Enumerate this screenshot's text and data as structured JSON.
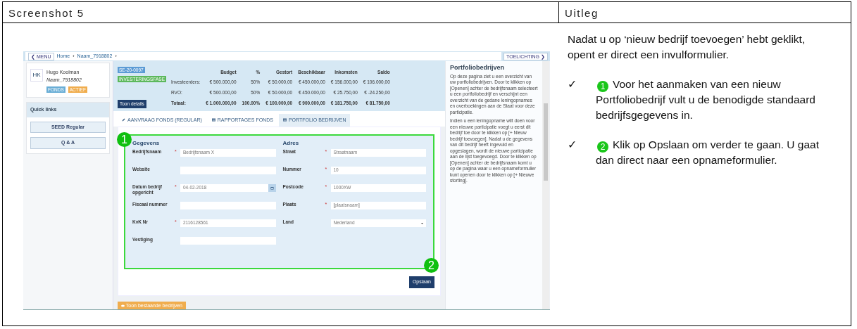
{
  "document": {
    "columns": [
      "Screenshot 5",
      "Uitleg"
    ]
  },
  "screenshot": {
    "topbar": {
      "menu": "❮ MENU",
      "breadcrumbs": [
        "Home",
        "Naam_7918802"
      ],
      "separator": "›",
      "help_button": "TOELICHTING ❯"
    },
    "profile": {
      "initials": "HK",
      "name": "Hugo Koolman",
      "account": "Naam_7918802",
      "badges": [
        {
          "label": "FONDS",
          "color": "#6aaed6"
        },
        {
          "label": "ACTIEF",
          "color": "#f0ad4e"
        }
      ]
    },
    "quick_links": {
      "title": "Quick links",
      "items": [
        "SEED Regular",
        "Q & A"
      ]
    },
    "fund": {
      "badges": [
        {
          "label": "SE-20-0097",
          "color": "#5b9bd5"
        },
        {
          "label": "INVESTERINGSFASE",
          "color": "#5cb85c"
        }
      ],
      "columns": [
        "",
        "Budget",
        "%",
        "Gestort",
        "Beschikbaar",
        "Inkomsten",
        "Saldo"
      ],
      "rows": [
        {
          "cells": [
            "Investeerders:",
            "€ 500.000,00",
            "50%",
            "€ 50.000,00",
            "€ 450.000,00",
            "€ 156.000,00",
            "€ 106.000,00"
          ],
          "total": false
        },
        {
          "cells": [
            "RVO:",
            "€ 500.000,00",
            "50%",
            "€ 50.000,00",
            "€ 450.000,00",
            "€ 25.750,00",
            "€ -24.250,00"
          ],
          "total": false
        },
        {
          "cells": [
            "Totaal:",
            "€ 1.000.000,00",
            "100.00%",
            "€ 100.000,00",
            "€ 900.000,00",
            "€ 181.750,00",
            "€ 81.750,00"
          ],
          "total": true
        }
      ],
      "details_button": "Toon details"
    },
    "tabs": [
      {
        "label": "AANVRAAG FONDS (REGULAR)",
        "kind": "pencil",
        "selected": false
      },
      {
        "label": "RAPPORTAGES FONDS",
        "kind": "list",
        "selected": false
      },
      {
        "label": "PORTFOLIO BEDRIJVEN",
        "kind": "list",
        "selected": true
      }
    ],
    "form": {
      "sections": [
        {
          "title": "Gegevens",
          "fields": [
            {
              "label": "Bedrijfsnaam",
              "required": true,
              "kind": "text",
              "value": "Bedrijfsnaam X"
            },
            {
              "label": "Website",
              "required": false,
              "kind": "text"
            },
            {
              "label": "Datum bedrijf opgericht",
              "required": true,
              "kind": "date",
              "value": "04-02-2018"
            },
            {
              "label": "Fiscaal nummer",
              "required": false,
              "kind": "text"
            },
            {
              "label": "KvK Nr",
              "required": true,
              "kind": "text",
              "value": "2116128561"
            },
            {
              "label": "Vestiging",
              "required": false,
              "kind": "text"
            }
          ]
        },
        {
          "title": "Adres",
          "fields": [
            {
              "label": "Straat",
              "required": true,
              "kind": "text",
              "value": "Straatnaam"
            },
            {
              "label": "Nummer",
              "required": true,
              "kind": "text",
              "value": "10"
            },
            {
              "label": "Postcode",
              "required": true,
              "kind": "text",
              "value": "1000XW"
            },
            {
              "label": "Plaats",
              "required": true,
              "kind": "text",
              "value": "[plaatsnaam]"
            },
            {
              "label": "Land",
              "required": false,
              "kind": "select",
              "value": "Nederland"
            }
          ]
        }
      ],
      "required_mark": "*",
      "save_button": "Opslaan"
    },
    "existing_button": "Toon bestaande bedrijven",
    "help": {
      "title": "Portfoliobedrijven",
      "paragraphs": [
        "Op deze pagina ziet u een overzicht van uw portfoliobedrijven. Door te klikken op [Openen] achter de bedrijfsnaam selecteert u een portfoliobedrijf en verschijnt een overzicht van de gedane leningopnames en overboekingen aan de Staat voor deze participatie.",
        "Indien u een leningopname wilt doen voor een nieuwe participatie voegt u eerst dit bedrijf toe door te klikken op [+ Nieuw bedrijf toevoegen]. Nadat u de gegevens van dit bedrijf heeft ingevuld en opgeslagen, wordt de nieuwe participatie aan de lijst toegevoegd. Door te klikken op [Openen] achter de bedrijfsnaam komt u op de pagina waar u een opnameformulier kunt openen door te klikken op [+ Nieuwe storting]."
      ]
    },
    "callouts": [
      "1",
      "2"
    ]
  },
  "explanation": {
    "intro": "Nadat u op ‘nieuw bedrijf toevoegen’ hebt geklikt, opent er direct een invulformulier.",
    "steps": [
      {
        "mark": "✓",
        "number": "1",
        "text": "Voor het aanmaken van een nieuw Portfoliobedrijf vult u de benodigde standaard bedrijfsgegevens in."
      },
      {
        "mark": "✓",
        "number": "2",
        "text": "Klik op Opslaan om verder te gaan. U gaat dan direct naar een opnameformulier."
      }
    ]
  }
}
